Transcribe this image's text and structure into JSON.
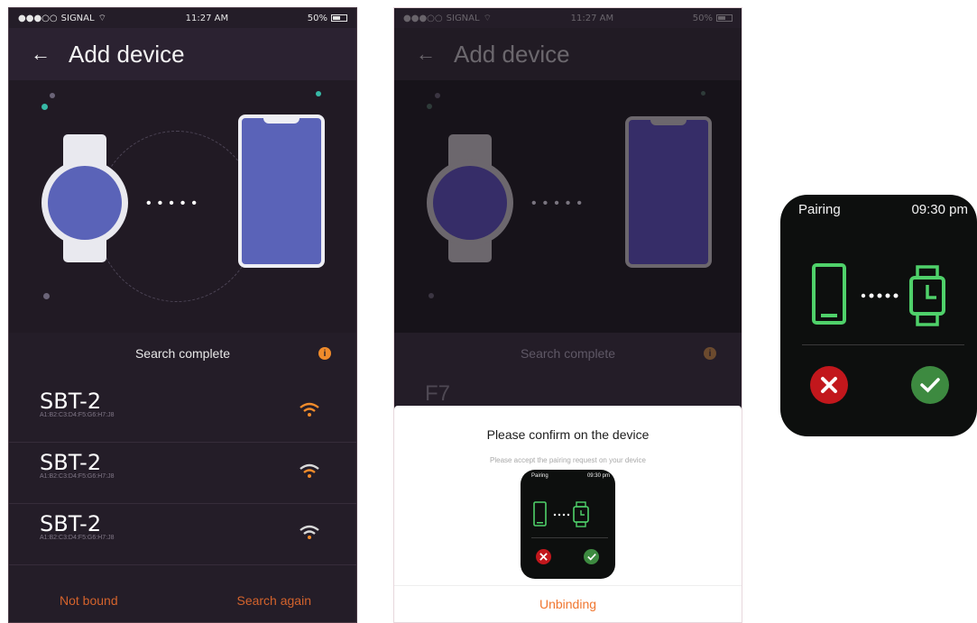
{
  "status_bar": {
    "carrier": "SIGNAL",
    "time": "11:27 AM",
    "battery": "50%"
  },
  "screen1": {
    "title": "Add device",
    "search_status": "Search complete",
    "info_icon": "i",
    "devices": [
      {
        "name": "SBT-2",
        "mac": "A1:B2:C3:D4:F5:G6:H7:J8"
      },
      {
        "name": "SBT-2",
        "mac": "A1:B2:C3:D4:F5:G6:H7:J8"
      },
      {
        "name": "SBT-2",
        "mac": "A1:B2:C3:D4:F5:G6:H7:J8"
      }
    ],
    "not_bound_label": "Not bound",
    "search_again_label": "Search again"
  },
  "screen2": {
    "title": "Add device",
    "search_status": "Search complete",
    "partial_device_name": "F7",
    "sheet_title": "Please confirm on the device",
    "sheet_subtitle": "Please accept the pairing request on your device",
    "unbinding_label": "Unbinding"
  },
  "watch_pairing": {
    "title": "Pairing",
    "time": "09:30 pm"
  },
  "colors": {
    "background": "#241d28",
    "accent_orange": "#f08b2b",
    "device_blue": "#5a63b8",
    "confirm_green": "#3d8a40",
    "reject_red": "#c2171c",
    "pairing_icon_green": "#4fd16a"
  },
  "icons": [
    "back-arrow-icon",
    "wifi-icon",
    "info-icon",
    "phone-icon",
    "watch-icon",
    "close-icon",
    "check-icon",
    "battery-icon"
  ]
}
